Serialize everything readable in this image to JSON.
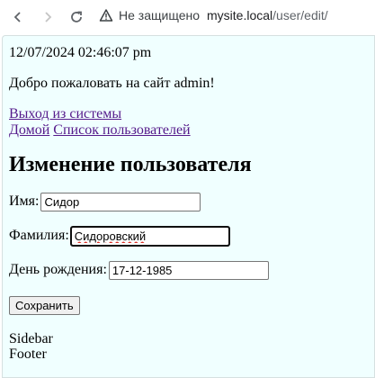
{
  "browser": {
    "security_label": "Не защищено",
    "url_host": "mysite.local",
    "url_path": "/user/edit/"
  },
  "page": {
    "datetime": "12/07/2024 02:46:07 pm",
    "welcome": "Добро пожаловать на сайт admin!",
    "logout_link": "Выход из системы",
    "home_link": "Домой",
    "users_link": "Список пользователей",
    "heading": "Изменение пользователя",
    "form": {
      "first_name_label": "Имя:",
      "first_name_value": "Сидор",
      "last_name_label": "Фамилия:",
      "last_name_value": "Сидоровский",
      "birthday_label": "День рождения:",
      "birthday_value": "17-12-1985",
      "save_label": "Сохранить"
    },
    "sidebar": "Sidebar",
    "footer": "Footer"
  }
}
